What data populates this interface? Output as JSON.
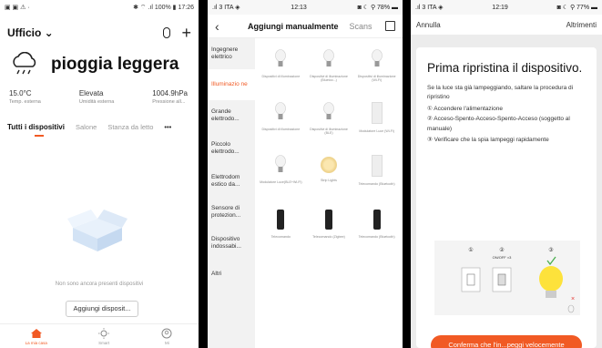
{
  "screen1": {
    "status": {
      "left": "▣ ▣ ⚠ ·",
      "right": "✱ ⌔ .ıl 100% ▮ 17:26"
    },
    "home_title": "Ufficio ⌄",
    "weather": "pioggia leggera",
    "stats": [
      {
        "value": "15.0°C",
        "label": "Temp. esterna"
      },
      {
        "value": "Elevata",
        "label": "Umidità esterna"
      },
      {
        "value": "1004.9hPa",
        "label": "Pressione all..."
      }
    ],
    "tabs": [
      "Tutti i dispositivi",
      "Salone",
      "Stanza da letto",
      "•••"
    ],
    "empty_text": "Non sono ancora presenti dispositivi",
    "add_button": "Aggiungi disposit...",
    "nav": [
      "La mia casa",
      "Smart",
      "Mi"
    ]
  },
  "screen2": {
    "status": {
      "left": ".ıl 3 ITA ◈",
      "center": "12:13",
      "right": "◙ ☾ ⚲ 78% ▬"
    },
    "tab_active": "Aggiungi manualmente",
    "tab_other": "Scans",
    "categories": [
      "Ingegnere elettrico",
      "Illuminazio ne",
      "Grande elettrodo...",
      "Piccolo elettrodo...",
      "Elettrodom estico da...",
      "Sensore di protezion...",
      "Dispositivo indossabi...",
      "Altri"
    ],
    "devices": [
      "Dispositivi di illuminazione",
      "Dispositivi di illuminazione (Bluetoo...)",
      "Dispositivi di illuminazione (Wi-Fi)",
      "Dispositivi di illuminazione",
      "Dispositivi di illuminazione (BLE)",
      "Modulatore Luce (Wi-Fi)",
      "Modulatore Luce(BLE+Wi-Fi)",
      "Strip Lights",
      "Telecomando (Bluetooth)",
      "Telecomando",
      "Telecomando (Zigbee)",
      "Telecomando (Bluetooth)"
    ]
  },
  "screen3": {
    "status": {
      "left": ".ıl 3 ITA ◈",
      "center": "12:19",
      "right": "◙ ☾ ⚲ 77% ▬"
    },
    "cancel": "Annulla",
    "other": "Altrimenti",
    "heading": "Prima ripristina il dispositivo.",
    "intro": "Se la luce sta già lampeggiando, saltare la procedura di ripristino",
    "steps": [
      "① Accendere l'alimentazione",
      "② Acceso-Spento-Acceso-Spento-Acceso (soggetto al manuale)",
      "③ Verificare che la spia lampeggi rapidamente"
    ],
    "illus_labels": [
      "①",
      "②",
      "③",
      "ON/OFF ×3"
    ],
    "confirm": "Conferma che l'in...peggi velocemente"
  }
}
